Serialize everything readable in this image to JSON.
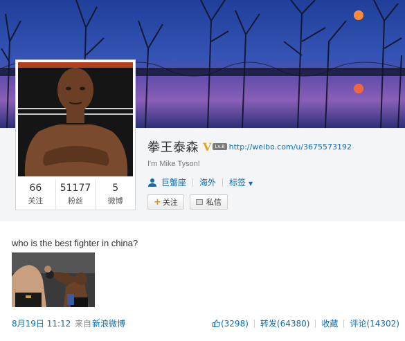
{
  "profile": {
    "name": "拳王泰森",
    "verified_mark": "V",
    "level_badge": "Lv.8",
    "url": "http://weibo.com/u/3675573192",
    "bio": "I'm Mike Tyson!"
  },
  "stats": [
    {
      "value": "66",
      "label": "关注"
    },
    {
      "value": "51177",
      "label": "粉丝"
    },
    {
      "value": "5",
      "label": "微博"
    }
  ],
  "tags": {
    "zodiac": "巨蟹座",
    "location": "海外",
    "tags_label": "标签"
  },
  "buttons": {
    "follow": "关注",
    "message": "私信"
  },
  "post": {
    "text": "who is the best fighter in china?",
    "time": "8月19日  11:12",
    "source_label": "来自",
    "source_link": "新浪微博",
    "likes": "(3298)",
    "repost": "转发(64380)",
    "favorite": "收藏",
    "comment": "评论(14302)"
  },
  "icons": {
    "person": "person-icon",
    "dropdown": "chevron-down-icon",
    "plus": "plus-icon",
    "mail": "mail-icon",
    "like": "thumbs-up-icon"
  },
  "colors": {
    "link": "#0a6eb4",
    "verified": "#e8a412",
    "follow_plus": "#f28c00"
  }
}
